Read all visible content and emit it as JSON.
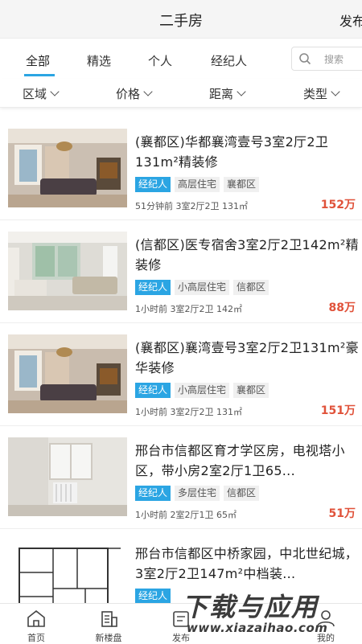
{
  "header": {
    "title": "二手房",
    "publish_label": "发布"
  },
  "tabs": [
    {
      "label": "全部",
      "active": true
    },
    {
      "label": "精选",
      "active": false
    },
    {
      "label": "个人",
      "active": false
    },
    {
      "label": "经纪人",
      "active": false
    }
  ],
  "search": {
    "placeholder": "搜索",
    "icon": "search-icon"
  },
  "filters": [
    {
      "label": "区域"
    },
    {
      "label": "价格"
    },
    {
      "label": "距离"
    },
    {
      "label": "类型"
    }
  ],
  "listings": [
    {
      "title": "(襄都区)华都襄湾壹号3室2厅2卫131m²精装修",
      "tags": [
        "经纪人",
        "高层住宅",
        "襄都区"
      ],
      "meta": "51分钟前  3室2厅2卫  131㎡",
      "price": "152万"
    },
    {
      "title": "(信都区)医专宿舍3室2厅2卫142m²精装修",
      "tags": [
        "经纪人",
        "小高层住宅",
        "信都区"
      ],
      "meta": "1小时前  3室2厅2卫  142㎡",
      "price": "88万"
    },
    {
      "title": "(襄都区)襄湾壹号3室2厅2卫131m²豪华装修",
      "tags": [
        "经纪人",
        "小高层住宅",
        "襄都区"
      ],
      "meta": "1小时前  3室2厅2卫  131㎡",
      "price": "151万"
    },
    {
      "title": "邢台市信都区育才学区房，电视塔小区，带小房2室2厅1卫65...",
      "tags": [
        "经纪人",
        "多层住宅",
        "信都区"
      ],
      "meta": "1小时前  2室2厅1卫  65㎡",
      "price": "51万"
    },
    {
      "title": "邢台市信都区中桥家园，中北世纪城，3室2厅2卫147m²中档装...",
      "tags": [
        "经纪人"
      ],
      "meta": "",
      "price": ""
    }
  ],
  "bottom_nav": [
    {
      "label": "首页",
      "icon": "home-icon"
    },
    {
      "label": "新楼盘",
      "icon": "building-icon"
    },
    {
      "label": "发布",
      "icon": "publish-icon"
    },
    {
      "label": "",
      "icon": ""
    },
    {
      "label": "我的",
      "icon": "user-icon"
    }
  ],
  "watermark": {
    "main": "下载与应用",
    "url": "www.xiazaihao.com"
  },
  "colors": {
    "accent": "#2ba5e3",
    "price": "#e0523a"
  }
}
